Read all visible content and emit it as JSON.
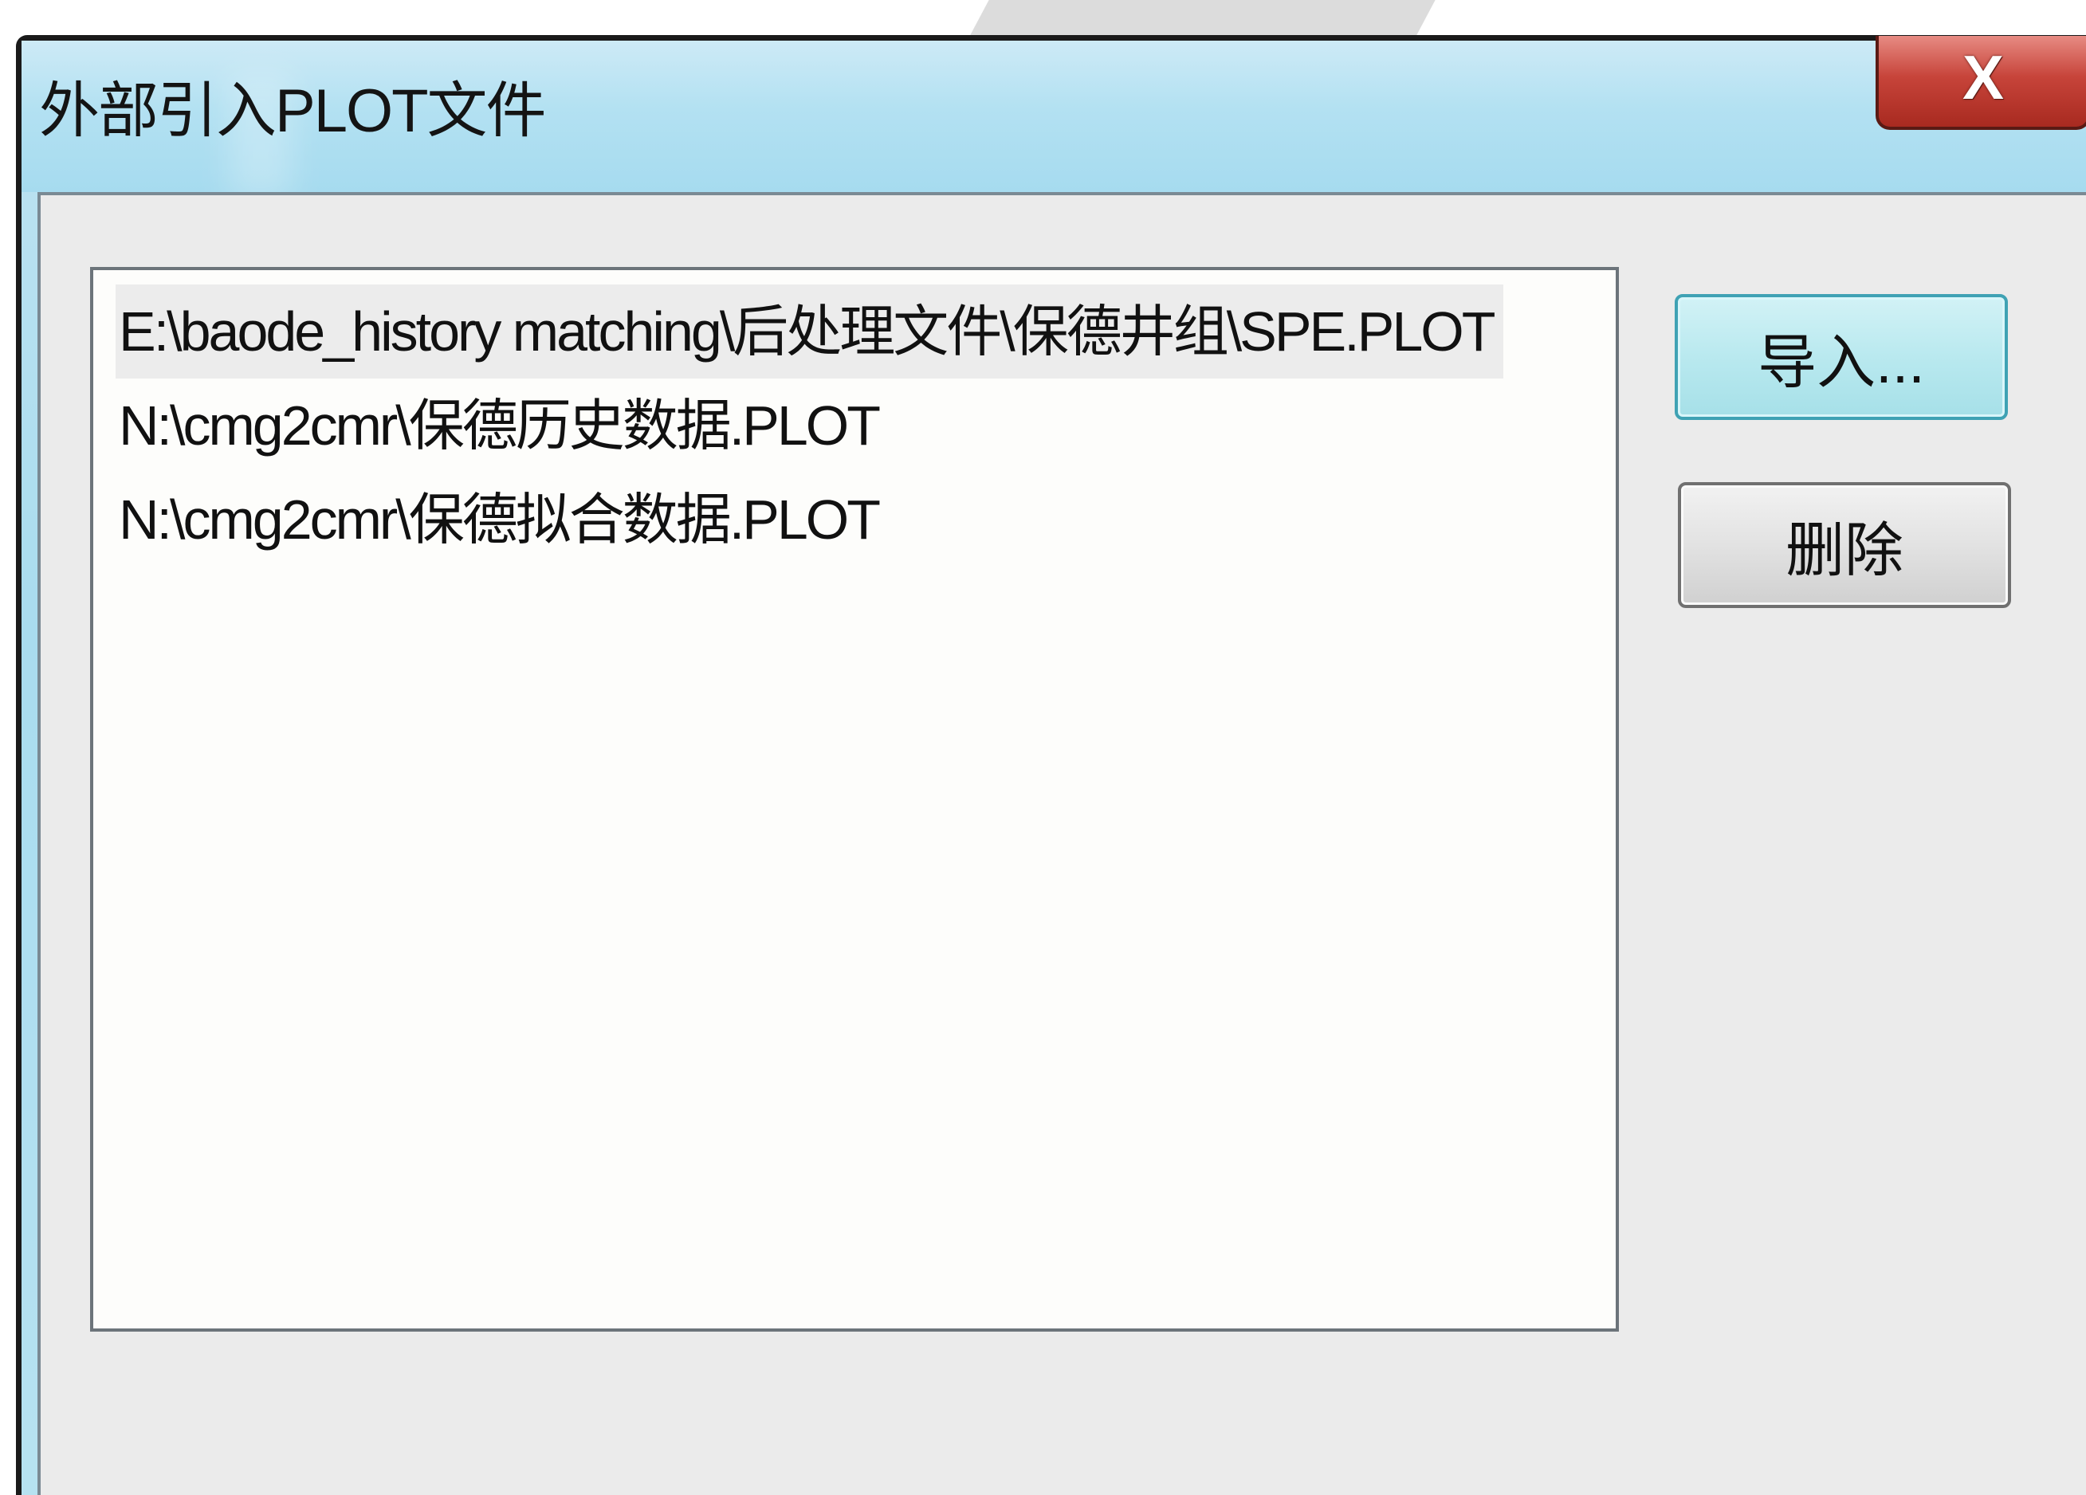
{
  "window": {
    "title": "外部引入PLOT文件",
    "close_label": "X"
  },
  "file_list": {
    "items": [
      {
        "path": "E:\\baode_history matching\\后处理文件\\保德井组\\SPE.PLOT",
        "selected": true
      },
      {
        "path": "N:\\cmg2cmr\\保德历史数据.PLOT",
        "selected": false
      },
      {
        "path": "N:\\cmg2cmr\\保德拟合数据.PLOT",
        "selected": false
      }
    ]
  },
  "buttons": {
    "import_label": "导入...",
    "delete_label": "删除"
  },
  "colors": {
    "titlebar": "#b3e1f2",
    "client_bg": "#ebebeb",
    "list_bg": "#fdfdfb",
    "close_button": "#c7443a",
    "import_button_border": "#3fa2b4",
    "selected_row": "#ececec"
  },
  "icons": {
    "close": "close-icon"
  }
}
